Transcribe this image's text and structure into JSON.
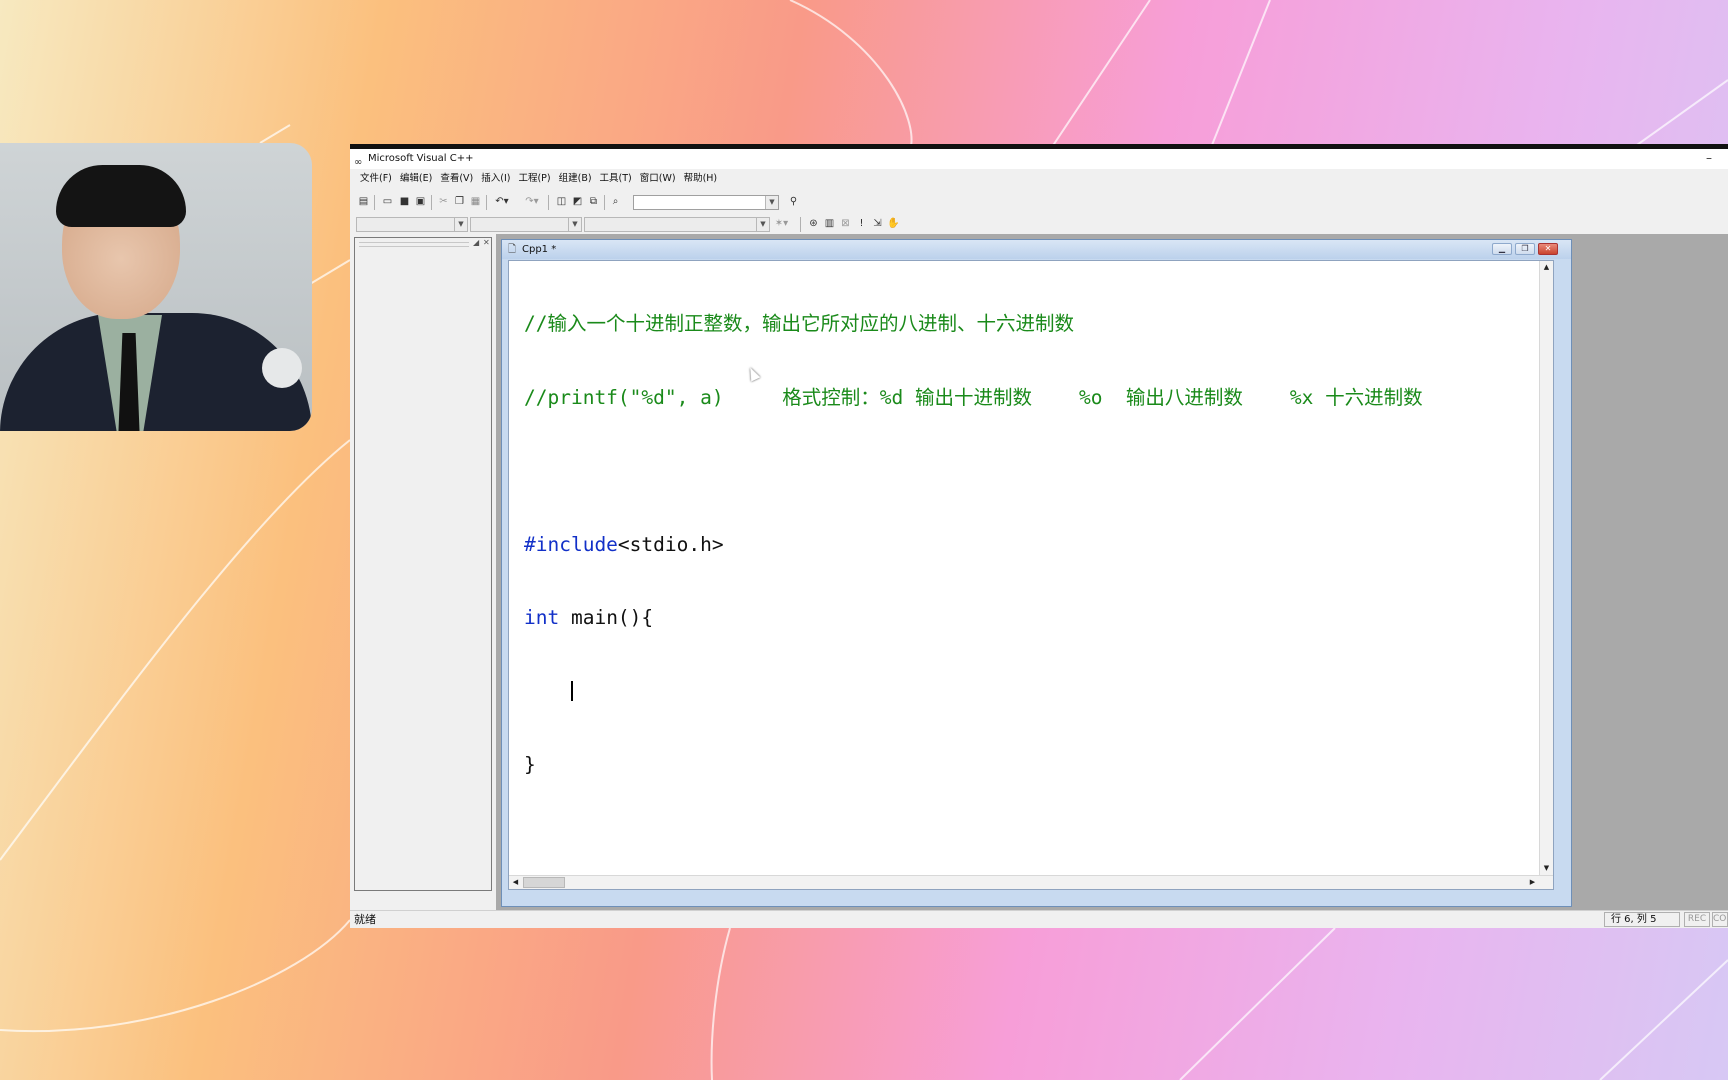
{
  "window": {
    "title": "Microsoft Visual C++",
    "min_glyph": "–"
  },
  "menu": {
    "items": [
      "文件(F)",
      "编辑(E)",
      "查看(V)",
      "插入(I)",
      "工程(P)",
      "组建(B)",
      "工具(T)",
      "窗口(W)",
      "帮助(H)"
    ]
  },
  "document": {
    "title": "Cpp1 *",
    "code_lines": [
      "//输入一个十进制正整数，输出它所对应的八进制、十六进制数",
      "//printf(\"%d\", a)     格式控制：%d 输出十进制数    %o  输出八进制数    %x 十六进制数",
      "",
      "#include<stdio.h>",
      "int main(){",
      "    ",
      "}"
    ],
    "keyword_int": "int",
    "main_rest": " main(){",
    "include_directive": "#include",
    "include_rest": "<stdio.h>"
  },
  "status": {
    "text": "就绪",
    "position": "行 6, 列 5",
    "rec": "REC",
    "col": "COL"
  },
  "icons": {
    "app": "vc-logo-icon",
    "doc": "document-icon"
  }
}
